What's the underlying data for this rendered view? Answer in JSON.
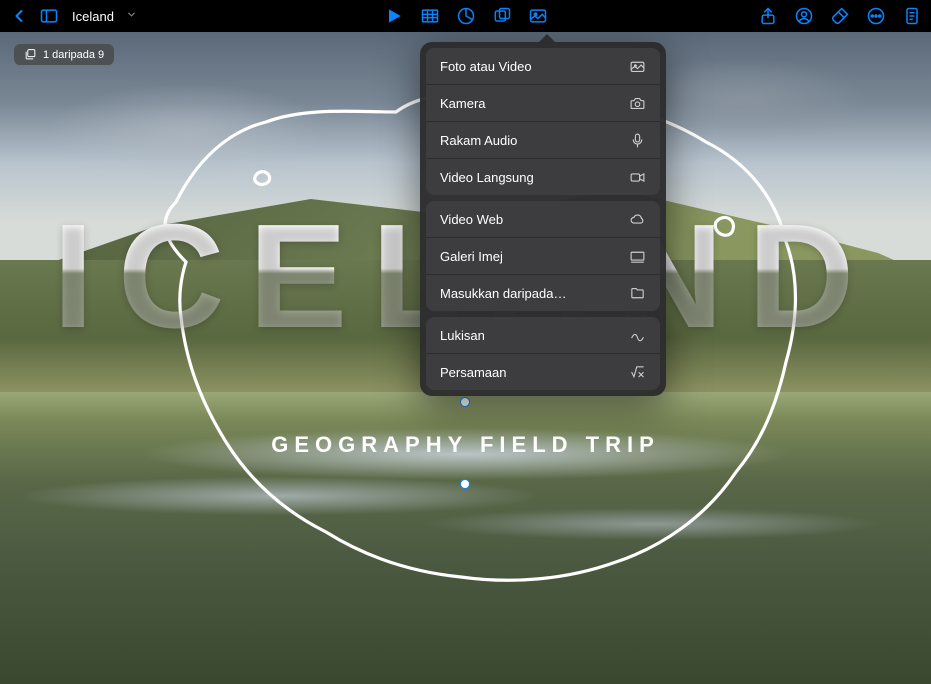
{
  "toolbar": {
    "doc_title": "Iceland"
  },
  "slide_indicator": {
    "label": "1 daripada 9"
  },
  "slide": {
    "title": "ICELAND",
    "subtitle": "GEOGRAPHY FIELD TRIP"
  },
  "insert_menu": {
    "groups": [
      {
        "items": [
          {
            "label": "Foto atau Video",
            "icon": "photo-video-icon"
          },
          {
            "label": "Kamera",
            "icon": "camera-icon"
          },
          {
            "label": "Rakam Audio",
            "icon": "microphone-icon"
          },
          {
            "label": "Video Langsung",
            "icon": "video-camera-icon"
          }
        ]
      },
      {
        "items": [
          {
            "label": "Video Web",
            "icon": "cloud-icon"
          },
          {
            "label": "Galeri Imej",
            "icon": "gallery-icon"
          },
          {
            "label": "Masukkan daripada…",
            "icon": "folder-icon"
          }
        ]
      },
      {
        "items": [
          {
            "label": "Lukisan",
            "icon": "scribble-icon"
          },
          {
            "label": "Persamaan",
            "icon": "equation-icon"
          }
        ]
      }
    ]
  }
}
